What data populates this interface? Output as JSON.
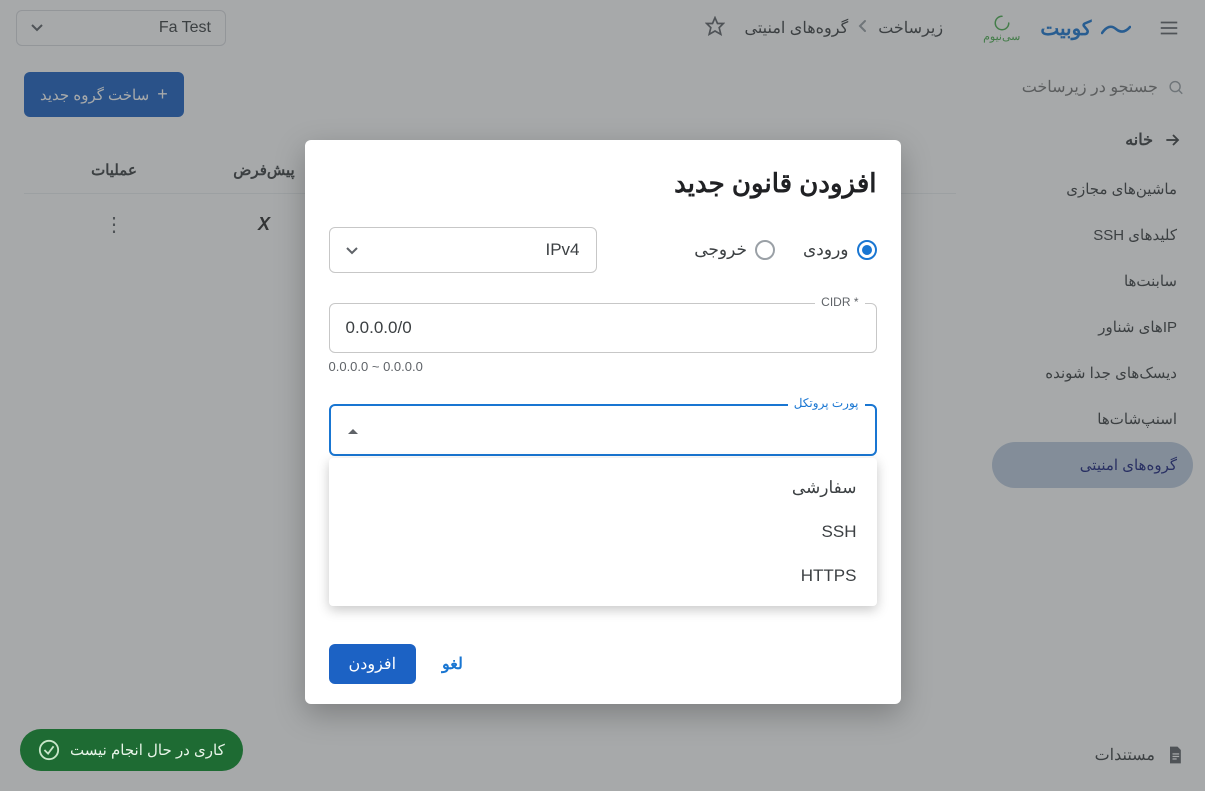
{
  "header": {
    "brand_primary": "کوبیت",
    "brand_secondary": "سی‌نیوم",
    "breadcrumbs": [
      "زیرساخت",
      "گروه‌های امنیتی"
    ],
    "project_selected": "Fa Test"
  },
  "sidebar": {
    "search_placeholder": "جستجو در زیرساخت",
    "home_label": "خانه",
    "items": [
      {
        "label": "ماشین‌های مجازی",
        "active": false
      },
      {
        "label": "کلید‌های SSH",
        "active": false
      },
      {
        "label": "سابنت‌ها",
        "active": false
      },
      {
        "label": "IPهای شناور",
        "active": false
      },
      {
        "label": "دیسک‌های جدا شونده",
        "active": false
      },
      {
        "label": "اسنپ‌شات‌ها",
        "active": false
      },
      {
        "label": "گروه‌های امنیتی",
        "active": true
      }
    ],
    "docs_label": "مستندات"
  },
  "main": {
    "create_group_label": "ساخت گروه جدید",
    "columns": {
      "ops": "عملیات",
      "default": "پیش‌فرض"
    },
    "row_default_mark": "X"
  },
  "modal": {
    "title": "افزودن قانون جدید",
    "direction": {
      "ingress": "ورودی",
      "egress": "خروجی"
    },
    "ip_version_selected": "IPv4",
    "cidr_label": "CIDR *",
    "cidr_value": "0.0.0.0/0",
    "cidr_hint": "0.0.0.0 ~ 0.0.0.0",
    "protocol_label": "پورت پروتکل",
    "protocol_options": [
      "سفارشی",
      "SSH",
      "HTTPS"
    ],
    "submit_label": "افزودن",
    "cancel_label": "لغو"
  },
  "status_pill": "کاری در حال انجام نیست"
}
